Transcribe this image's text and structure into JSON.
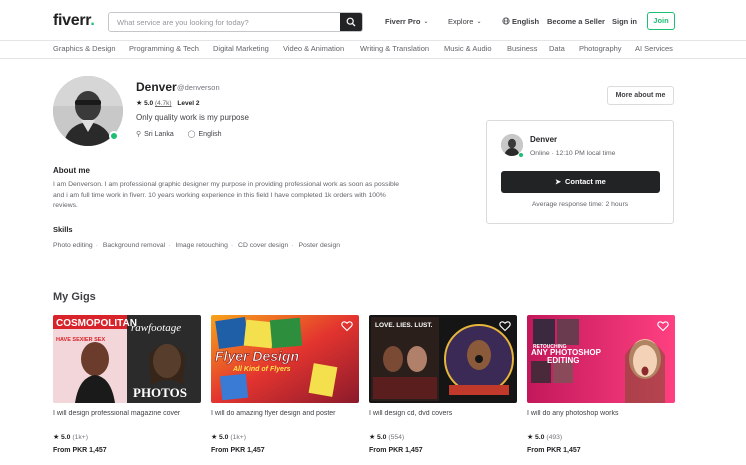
{
  "header": {
    "logo_text": "fiverr",
    "logo_dot": ".",
    "search_placeholder": "What service are you looking for today?",
    "nav": {
      "fiverr_pro": "Fiverr Pro",
      "explore": "Explore",
      "language": "English",
      "become_seller": "Become a Seller",
      "sign_in": "Sign in",
      "join": "Join"
    }
  },
  "categories": [
    "Graphics & Design",
    "Programming & Tech",
    "Digital Marketing",
    "Video & Animation",
    "Writing & Translation",
    "Music & Audio",
    "Business",
    "Data",
    "Photography",
    "AI Services"
  ],
  "profile": {
    "name": "Denver",
    "username": "@denverson",
    "rating": "5.0",
    "reviews": "(4.7k)",
    "level": "Level 2",
    "tagline": "Only quality work is my purpose",
    "country": "Sri Lanka",
    "language": "English",
    "more_about_me": "More about me",
    "about_heading": "About me",
    "about_text": "I am Denverson. I am professional graphic designer my purpose in providing professional work as soon as possible and i am full time work in fiverr. 10 years working experience in this field I have completed 1k orders with 100% reviews.",
    "skills_heading": "Skills",
    "skills": [
      "Photo editing",
      "Background removal",
      "Image retouching",
      "CD cover design",
      "Poster design"
    ]
  },
  "contact_card": {
    "name": "Denver",
    "status": "Online",
    "local_time": "12:10 PM local time",
    "contact_label": "Contact me",
    "response": "Average response time: 2 hours"
  },
  "gigs": {
    "heading": "My Gigs",
    "items": [
      {
        "title": "I will design professional magazine cover",
        "rating": "5.0",
        "count": "(1k+)",
        "price": "From PKR 1,457",
        "image_text": [
          "COSMOPOLITAN",
          "rawfootage",
          "PHOTOS",
          "HAVE SEXIER SEX"
        ]
      },
      {
        "title": "I will do amazing flyer design and poster",
        "rating": "5.0",
        "count": "(1k+)",
        "price": "From PKR 1,457",
        "image_text": [
          "Flyer Design",
          "All Kind of Flyers"
        ]
      },
      {
        "title": "I will design cd, dvd covers",
        "rating": "5.0",
        "count": "(554)",
        "price": "From PKR 1,457",
        "image_text": [
          "LOVE. LIES. LUST."
        ]
      },
      {
        "title": "I will do any photoshop works",
        "rating": "5.0",
        "count": "(493)",
        "price": "From PKR 1,457",
        "image_text": [
          "RETOUCHING",
          "ANY PHOTOSHOP",
          "EDITING"
        ]
      }
    ]
  },
  "colors": {
    "brand_green": "#1dbf73",
    "dark": "#222325",
    "text": "#404145",
    "muted": "#62646a"
  }
}
